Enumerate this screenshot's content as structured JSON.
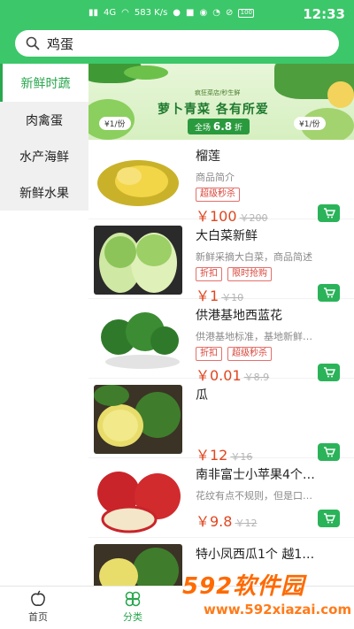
{
  "status_bar": {
    "network": "4G",
    "speed": "583 K/s",
    "battery": "100",
    "time": "12:33"
  },
  "search": {
    "value": "鸡蛋"
  },
  "sidebar": {
    "items": [
      {
        "label": "新鲜时蔬",
        "active": true
      },
      {
        "label": "肉禽蛋"
      },
      {
        "label": "水产海鲜"
      },
      {
        "label": "新鲜水果"
      }
    ]
  },
  "banner": {
    "subtitle": "疯狂菜店/秒生鲜",
    "title": "萝卜青菜 各有所爱",
    "promo_prefix": "全场",
    "promo_value": "6.8",
    "promo_suffix": "折",
    "left_price": "¥1/份",
    "right_price": "¥1/份"
  },
  "products": [
    {
      "name": "榴莲",
      "desc": "商品简介",
      "tags": [
        "超级秒杀"
      ],
      "price": "￥100",
      "old_price": "￥200"
    },
    {
      "name": "大白菜新鲜",
      "desc": "新鲜采摘大白菜，商品简述",
      "tags": [
        "折扣",
        "限时抢购"
      ],
      "price": "￥1",
      "old_price": "￥10"
    },
    {
      "name": "供港基地西蓝花",
      "desc": "供港基地标准，基地新鲜…",
      "tags": [
        "折扣",
        "超级秒杀"
      ],
      "price": "￥0.01",
      "old_price": "￥8.9"
    },
    {
      "name": "瓜",
      "desc": "",
      "tags": [],
      "price": "￥12",
      "old_price": "￥16"
    },
    {
      "name": "南非富士小苹果4个…",
      "desc": "花纹有点不规则，但是口…",
      "tags": [],
      "price": "￥9.8",
      "old_price": "￥12"
    },
    {
      "name": "特小凤西瓜1个 越1…",
      "desc": "",
      "tags": [],
      "price": "",
      "old_price": ""
    }
  ],
  "bottom_nav": {
    "tabs": [
      {
        "label": "首页",
        "icon": "home-apple-icon"
      },
      {
        "label": "分类",
        "icon": "category-clover-icon",
        "active": true
      }
    ]
  },
  "watermark": {
    "main": "592软件园",
    "url": "www.592xiazai.com"
  },
  "colors": {
    "brand_green": "#3cc76a",
    "price_red": "#e0461f",
    "tag_red": "#d9463a"
  }
}
